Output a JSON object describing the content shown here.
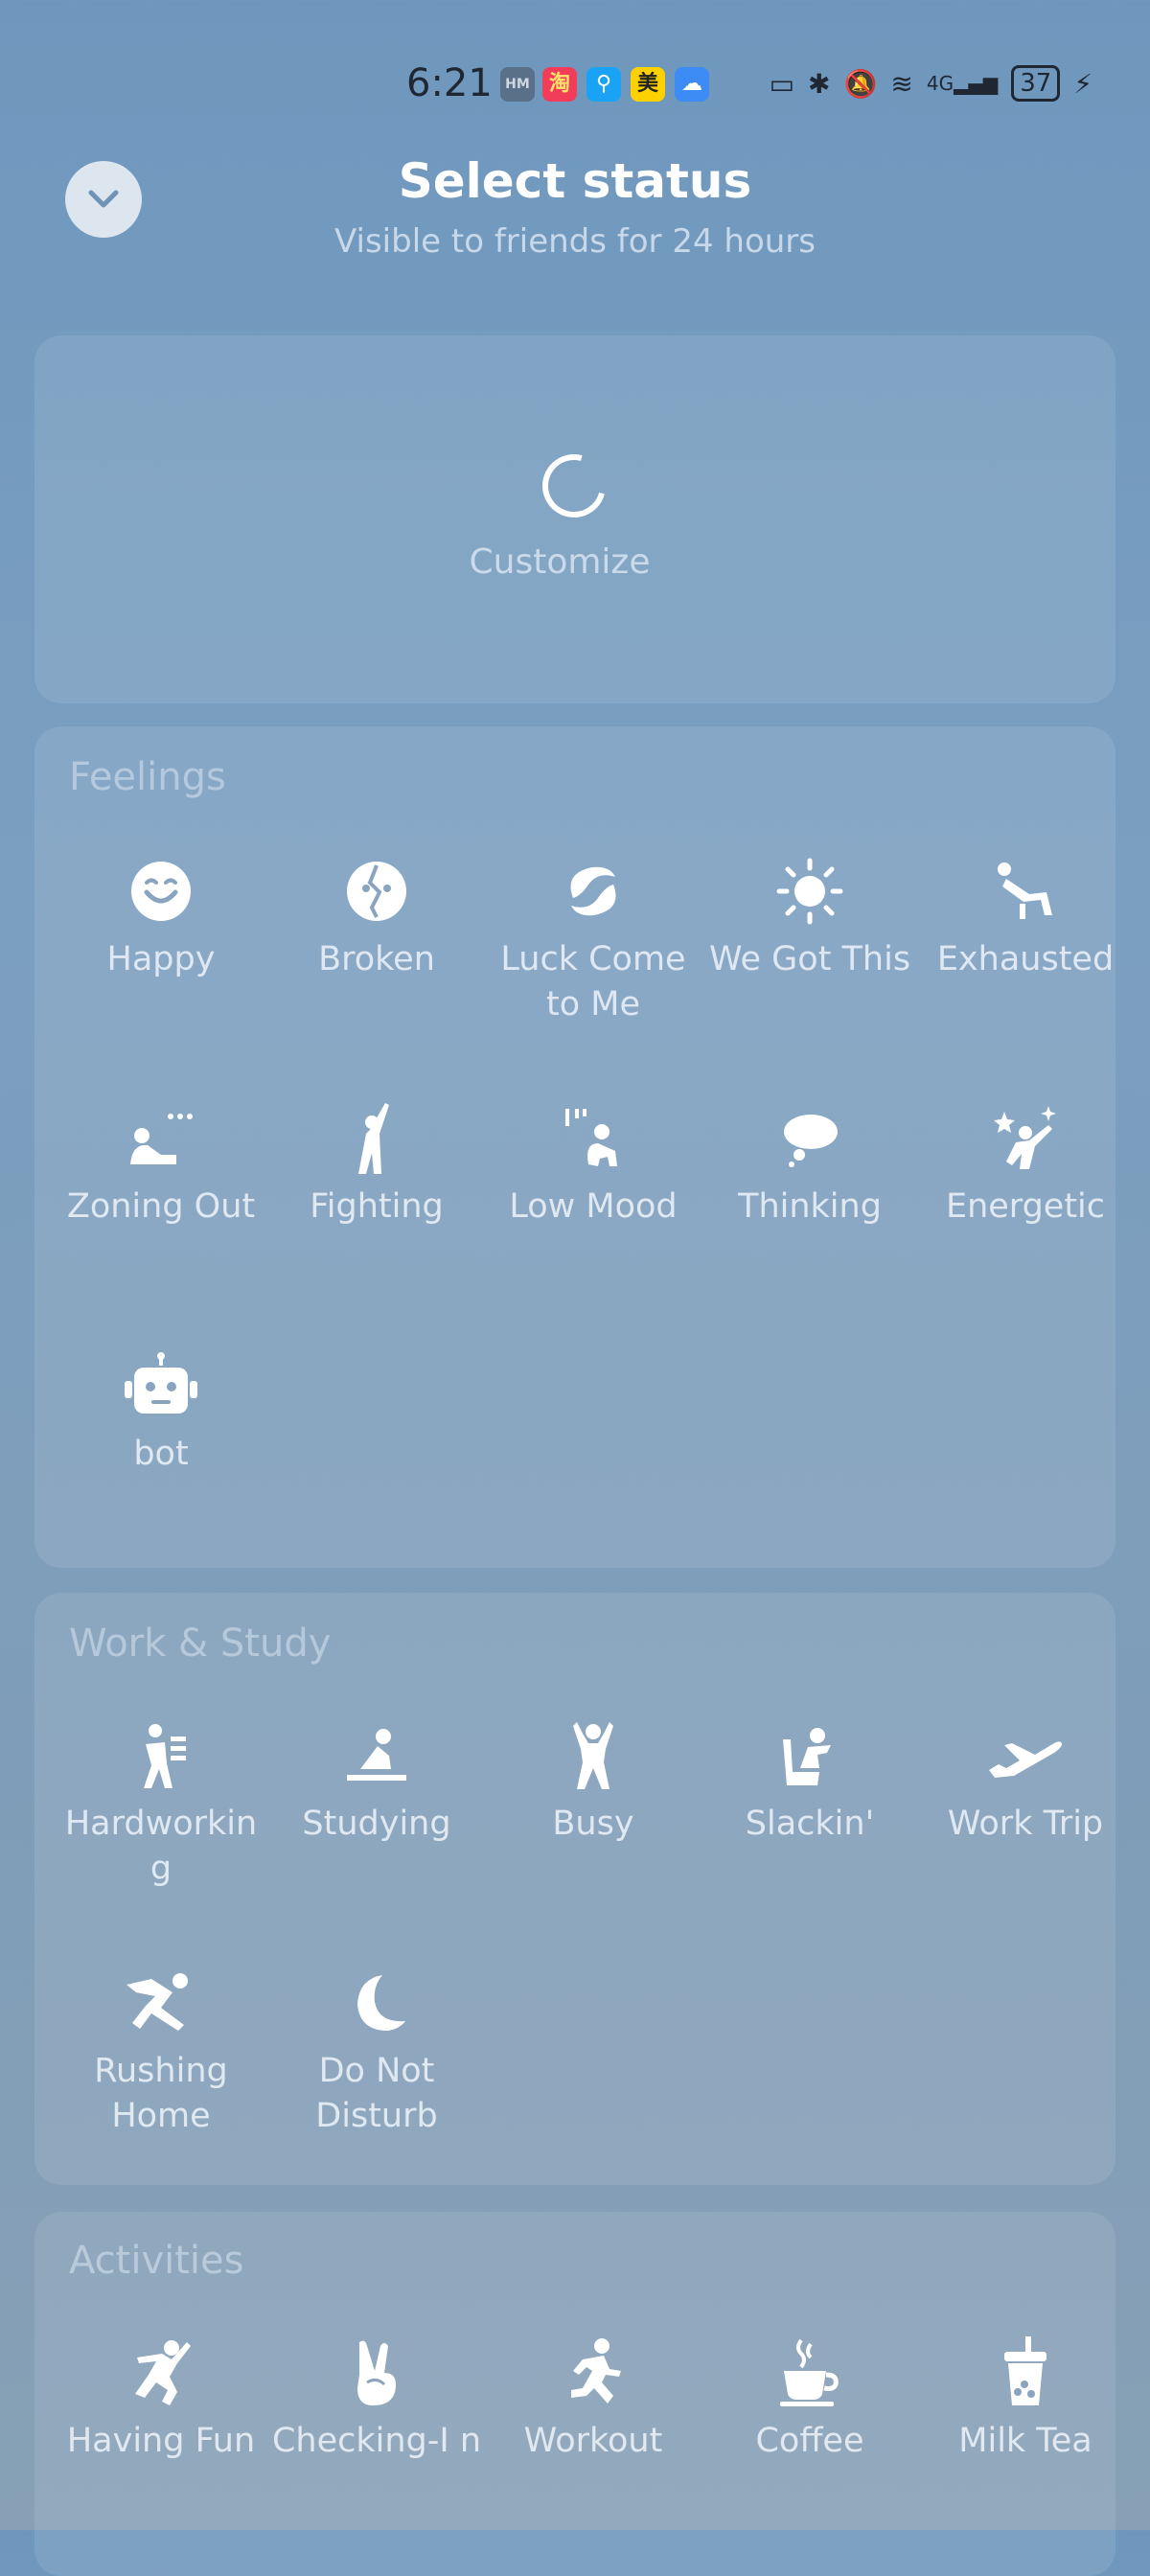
{
  "status_bar": {
    "time": "6:21",
    "battery": "37",
    "network": "4G"
  },
  "header": {
    "title": "Select status",
    "subtitle": "Visible to friends for 24 hours"
  },
  "customize": {
    "label": "Customize"
  },
  "sections": {
    "feelings": {
      "title": "Feelings",
      "items": [
        {
          "label": "Happy",
          "icon": "happy-face-icon"
        },
        {
          "label": "Broken",
          "icon": "broken-heart-icon"
        },
        {
          "label": "Luck Come to Me",
          "icon": "luck-swirl-icon"
        },
        {
          "label": "We Got This",
          "icon": "sun-icon"
        },
        {
          "label": "Exhausted",
          "icon": "exhausted-person-icon"
        },
        {
          "label": "Zoning Out",
          "icon": "zoning-out-icon"
        },
        {
          "label": "Fighting",
          "icon": "fighting-person-icon"
        },
        {
          "label": "Low Mood",
          "icon": "low-mood-person-icon"
        },
        {
          "label": "Thinking",
          "icon": "thought-cloud-icon"
        },
        {
          "label": "Energetic",
          "icon": "energetic-person-icon"
        },
        {
          "label": "bot",
          "icon": "robot-icon"
        }
      ]
    },
    "work": {
      "title": "Work & Study",
      "items": [
        {
          "label": "Hardworkin g",
          "icon": "hardworking-person-icon"
        },
        {
          "label": "Studying",
          "icon": "studying-person-icon"
        },
        {
          "label": "Busy",
          "icon": "busy-person-icon"
        },
        {
          "label": "Slackin'",
          "icon": "slacking-person-icon"
        },
        {
          "label": "Work Trip",
          "icon": "airplane-icon"
        },
        {
          "label": "Rushing Home",
          "icon": "rushing-person-icon"
        },
        {
          "label": "Do Not Disturb",
          "icon": "moon-icon"
        }
      ]
    },
    "activities": {
      "title": "Activities",
      "items": [
        {
          "label": "Having Fun",
          "icon": "dancing-person-icon"
        },
        {
          "label": "Checking-I n",
          "icon": "victory-hand-icon"
        },
        {
          "label": "Workout",
          "icon": "running-person-icon"
        },
        {
          "label": "Coffee",
          "icon": "coffee-cup-icon"
        },
        {
          "label": "Milk Tea",
          "icon": "milk-tea-icon"
        }
      ]
    }
  }
}
